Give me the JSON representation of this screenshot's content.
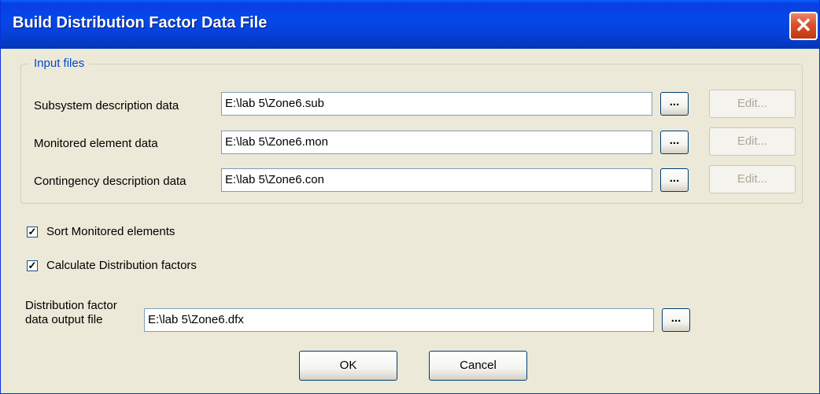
{
  "window": {
    "title": "Build Distribution Factor Data File",
    "close_symbol": "✕"
  },
  "input_files": {
    "legend": "Input files",
    "rows": [
      {
        "label": "Subsystem description data",
        "value": "E:\\lab 5\\Zone6.sub",
        "browse": "...",
        "edit": "Edit..."
      },
      {
        "label": "Monitored element data",
        "value": "E:\\lab 5\\Zone6.mon",
        "browse": "...",
        "edit": "Edit..."
      },
      {
        "label": "Contingency description data",
        "value": "E:\\lab 5\\Zone6.con",
        "browse": "...",
        "edit": "Edit..."
      }
    ]
  },
  "options": {
    "sort_monitored": {
      "label": "Sort Monitored elements",
      "checked": true,
      "mark": "✓"
    },
    "calc_factors": {
      "label": "Calculate Distribution factors",
      "checked": true,
      "mark": "✓"
    }
  },
  "output": {
    "label_line1": "Distribution factor",
    "label_line2": "data output file",
    "value": "E:\\lab 5\\Zone6.dfx",
    "browse": "..."
  },
  "buttons": {
    "ok": "OK",
    "cancel": "Cancel"
  }
}
